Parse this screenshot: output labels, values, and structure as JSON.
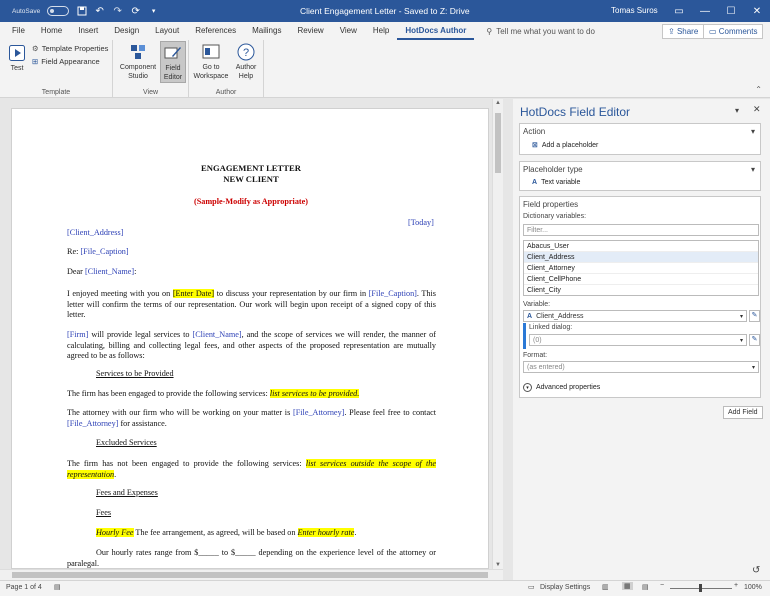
{
  "titlebar": {
    "autosave_label": "AutoSave",
    "autosave_state": "Off",
    "doc_title": "Client Engagement Letter - Saved to Z: Drive",
    "user": "Tomas Suros"
  },
  "tabs": [
    "File",
    "Home",
    "Insert",
    "Design",
    "Layout",
    "References",
    "Mailings",
    "Review",
    "View",
    "Help",
    "HotDocs Author"
  ],
  "tell_me": "Tell me what you want to do",
  "share_label": "Share",
  "comments_label": "Comments",
  "ribbon": {
    "template_group": {
      "test": "Test",
      "template_properties": "Template Properties",
      "field_appearance": "Field Appearance",
      "label": "Template"
    },
    "view_group": {
      "component_studio": [
        "Component",
        "Studio"
      ],
      "field_editor": [
        "Field",
        "Editor"
      ],
      "label": "View"
    },
    "author_group": {
      "go_to_workspace": [
        "Go to",
        "Workspace"
      ],
      "author_help": [
        "Author",
        "Help"
      ],
      "label": "Author"
    }
  },
  "document": {
    "title_line1": "ENGAGEMENT LETTER",
    "title_line2": "NEW CLIENT",
    "subtitle": "(Sample-Modify as Appropriate)",
    "today": "[Today]",
    "client_address": "[Client_Address]",
    "re_label": "Re: ",
    "file_caption": "[File_Caption]",
    "dear": "Dear ",
    "client_name": "[Client_Name]",
    "colon": ":",
    "para1_a": "I enjoyed meeting with you on ",
    "enter_date": "[Enter Date]",
    "para1_b": " to discuss your representation by our firm in ",
    "para1_c": ". This letter will confirm the terms of our representation.  Our work will begin upon receipt of a signed copy of this letter.",
    "firm": "[Firm]",
    "para2_a": " will provide legal services to ",
    "para2_b": ", and the scope of services we will render, the manner of calculating, billing and collecting legal fees, and other aspects of the proposed representation are mutually agreed to be as follows:",
    "heading_services": "Services to be Provided",
    "para3_a": "The firm has been engaged to provide the following services: ",
    "list_services": "list services to be provided.",
    "para4_a": "The attorney with our firm who will be working on your matter is ",
    "file_attorney": "[File_Attorney]",
    "para4_b": ".  Please feel free to contact ",
    "para4_c": " for assistance.",
    "heading_excluded": "Excluded Services",
    "para5_a": "The firm has not been engaged to provide the following services: ",
    "list_outside": "list services outside the scope of the representation",
    "period": ".",
    "heading_fees_exp": "Fees and Expenses",
    "heading_fees": "Fees",
    "hourly_fee": "Hourly Fee",
    "para6_a": "  The fee arrangement, as agreed, will be based on ",
    "enter_hourly_rate": "Enter hourly rate",
    "para7": "Our hourly rates range from $_____ to $_____ depending on the experience level of the attorney or paralegal."
  },
  "panel": {
    "title": "HotDocs Field Editor",
    "action_head": "Action",
    "action_value": "Add a placeholder",
    "ptype_head": "Placeholder type",
    "ptype_value": "Text variable",
    "fprops_head": "Field properties",
    "dict_label": "Dictionary variables:",
    "filter_placeholder": "Filter...",
    "dict_items": [
      "Abacus_User",
      "Client_Address",
      "Client_Attorney",
      "Client_CellPhone",
      "Client_City"
    ],
    "variable_label": "Variable:",
    "variable_value": "Client_Address",
    "linked_label": "Linked dialog:",
    "linked_value": "(0)",
    "format_label": "Format:",
    "format_value": "(as entered)",
    "advanced": "Advanced properties",
    "add_field": "Add Field"
  },
  "statusbar": {
    "page": "Page 1 of 4",
    "display_settings": "Display Settings",
    "zoom": "100%"
  },
  "colors": {
    "brand": "#2b579a",
    "field": "#2b3fb5",
    "highlight": "#ffff00",
    "subtitle": "#cc0000"
  }
}
